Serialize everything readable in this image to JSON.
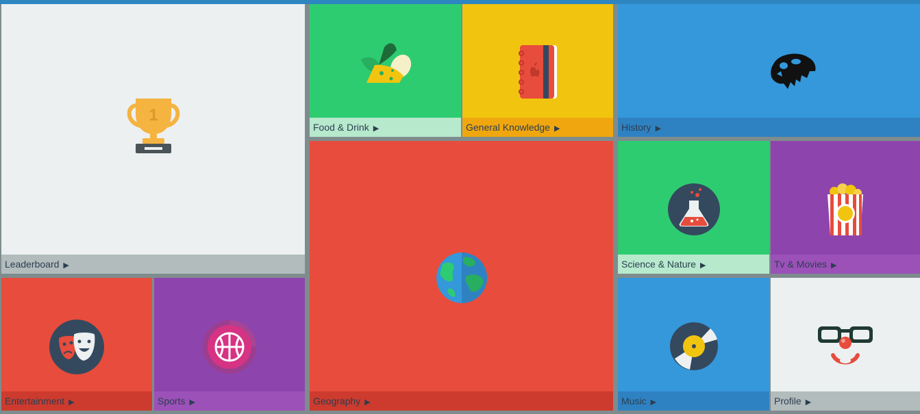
{
  "tiles": {
    "leaderboard": {
      "label": "Leaderboard",
      "icon": "trophy-icon",
      "rank_text": "1",
      "color": "#ecf0f1",
      "label_bg": "#b2bcbd"
    },
    "food_drink": {
      "label": "Food & Drink",
      "icon": "food-icon",
      "color": "#2ecc71",
      "label_bg": "#b7e9cd"
    },
    "general_knowledge": {
      "label": "General Knowledge",
      "icon": "notebook-icon",
      "color": "#f1c40f",
      "label_bg": "#f0a70f"
    },
    "history": {
      "label": "History",
      "icon": "dinosaur-skull-icon",
      "color": "#3498db",
      "label_bg": "#2f82c2"
    },
    "science_nature": {
      "label": "Science & Nature",
      "icon": "flask-icon",
      "color": "#2ecc71",
      "label_bg": "#b7e9cd"
    },
    "tv_movies": {
      "label": "Tv & Movies",
      "icon": "popcorn-icon",
      "color": "#8e44ad",
      "label_bg": "#9b51b8"
    },
    "entertainment": {
      "label": "Entertainment",
      "icon": "theater-masks-icon",
      "color": "#e74c3c",
      "label_bg": "#cc3b2e"
    },
    "sports": {
      "label": "Sports",
      "icon": "basketball-icon",
      "color": "#8e44ad",
      "label_bg": "#9b51b8"
    },
    "geography": {
      "label": "Geography",
      "icon": "globe-icon",
      "color": "#e74c3c",
      "label_bg": "#cc3b2e"
    },
    "music": {
      "label": "Music",
      "icon": "vinyl-record-icon",
      "color": "#3498db",
      "label_bg": "#2f82c2"
    },
    "profile": {
      "label": "Profile",
      "icon": "clown-glasses-icon",
      "color": "#ecf0f1",
      "label_bg": "#b2bcbd"
    }
  },
  "arrow_glyph": "▶"
}
